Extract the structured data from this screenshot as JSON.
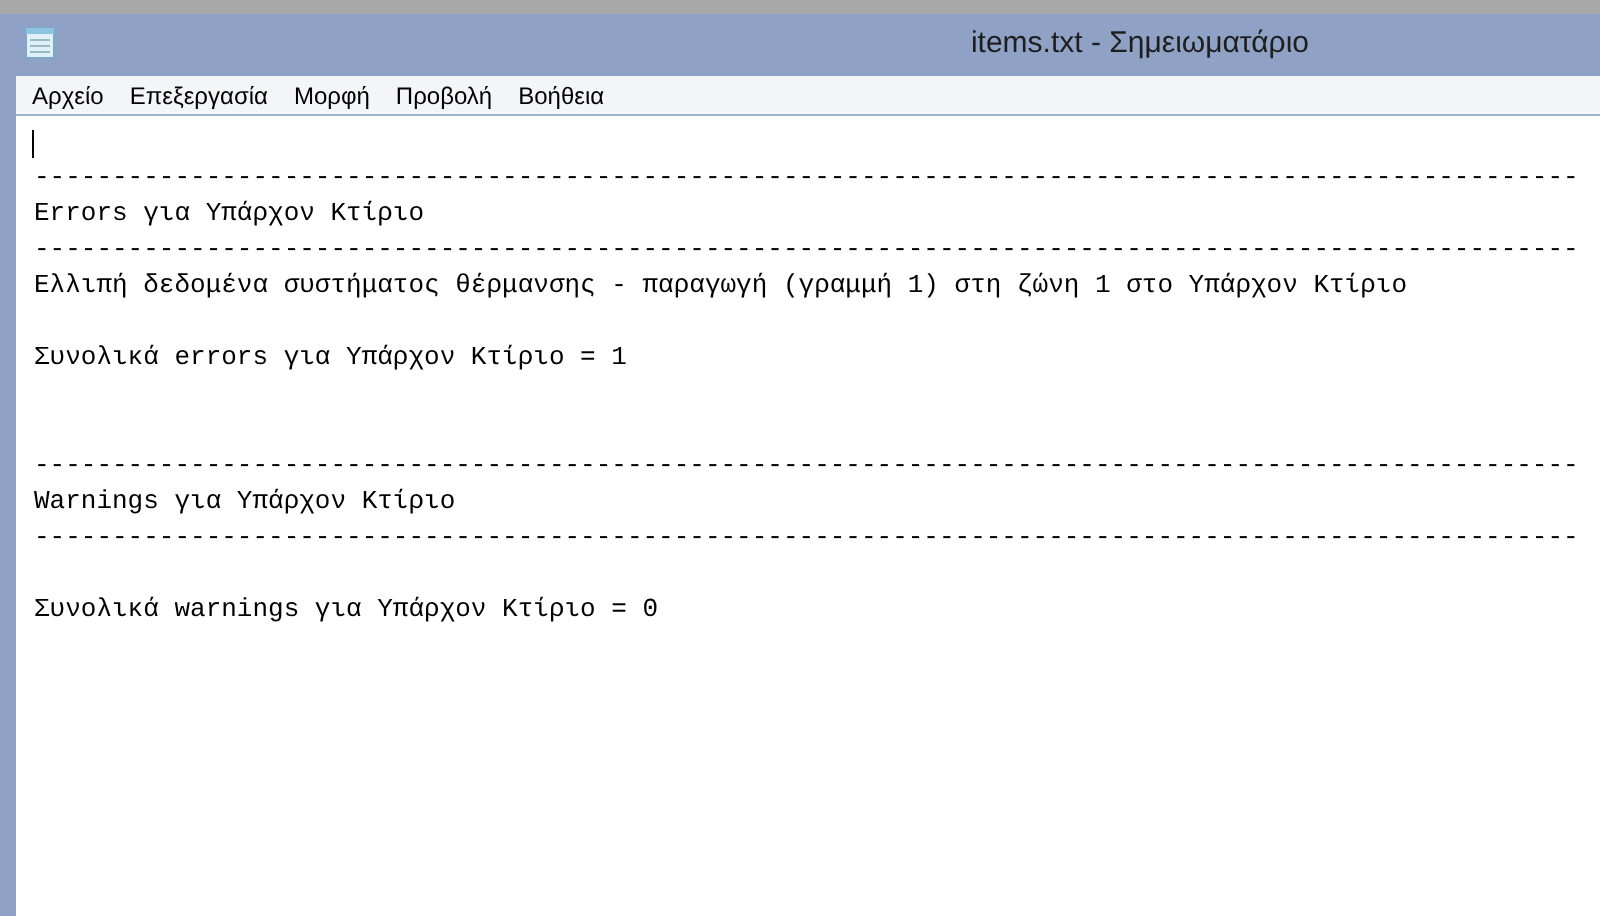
{
  "window": {
    "title": "items.txt - Σημειωματάριο"
  },
  "menu": [
    "Αρχείο",
    "Επεξεργασία",
    "Μορφή",
    "Προβολή",
    "Βοήθεια"
  ],
  "editor": {
    "lines": [
      {
        "kind": "blank"
      },
      {
        "kind": "text",
        "text": "---------------------------------------------------------------------------------------------------"
      },
      {
        "kind": "text",
        "text": "Errors για Υπάρχον Κτίριο"
      },
      {
        "kind": "text",
        "text": "---------------------------------------------------------------------------------------------------"
      },
      {
        "kind": "text",
        "text": "Ελλιπή δεδομένα συστήματος θέρμανσης - παραγωγή (γραμμή 1) στη ζώνη 1 στο Υπάρχον Κτίριο"
      },
      {
        "kind": "blank"
      },
      {
        "kind": "text",
        "text": "Συνολικά errors για Υπάρχον Κτίριο = 1"
      },
      {
        "kind": "blank"
      },
      {
        "kind": "blank"
      },
      {
        "kind": "text",
        "text": "---------------------------------------------------------------------------------------------------"
      },
      {
        "kind": "text",
        "text": "Warnings για Υπάρχον Κτίριο"
      },
      {
        "kind": "text",
        "text": "---------------------------------------------------------------------------------------------------"
      },
      {
        "kind": "blank"
      },
      {
        "kind": "text",
        "text": "Συνολικά warnings για Υπάρχον Κτίριο = 0"
      }
    ]
  }
}
